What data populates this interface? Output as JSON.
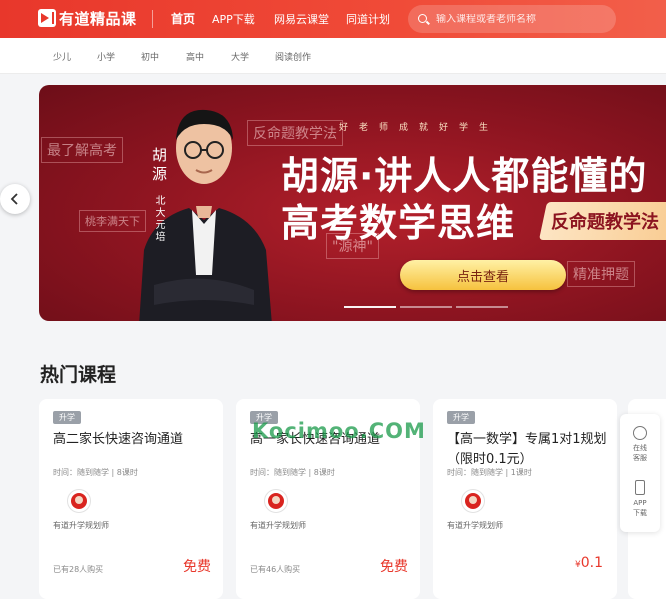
{
  "header": {
    "logo_text": "有道精品课",
    "nav": [
      {
        "label": "首页",
        "active": true
      },
      {
        "label": "APP下载",
        "active": false
      },
      {
        "label": "网易云课堂",
        "active": false
      },
      {
        "label": "同道计划",
        "active": false
      }
    ],
    "search_placeholder": "输入课程或者老师名称"
  },
  "subnav": [
    "少儿",
    "小学",
    "初中",
    "高中",
    "大学",
    "阅读创作"
  ],
  "banner": {
    "tags": [
      "反命题教学法",
      "最了解高考",
      "桃李满天下",
      "\"源神\"",
      "精准押题"
    ],
    "teacher_name": "胡源",
    "teacher_title": "北大元培",
    "slogan": "好老师成就好学生",
    "headline_line1": "胡源·讲人人都能懂的",
    "headline_line2": "高考数学思维",
    "ribbon": "反命题教学法",
    "cta": "点击查看",
    "prev_icon": "chevron-left-icon"
  },
  "section_title": "热门课程",
  "watermark": "Kocimoo.COM",
  "courses": [
    {
      "badge": "升学",
      "title": "高二家长快速咨询通道",
      "meta": "时间：随到随学 | 8课时",
      "teacher": "有道升学规划师",
      "buyers": "已有28人购买",
      "price": "免费"
    },
    {
      "badge": "升学",
      "title": "高一家长快速咨询通道",
      "meta": "时间：随到随学 | 8课时",
      "teacher": "有道升学规划师",
      "buyers": "已有46人购买",
      "price": "免费"
    },
    {
      "badge": "升学",
      "title": "【高一数学】专属1对1规划（限时0.1元）",
      "meta": "时间：随到随学 | 1课时",
      "teacher": "有道升学规划师",
      "buyers": "",
      "price_symbol": "¥",
      "price": "0.1"
    }
  ],
  "side_tools": [
    {
      "label_line1": "在线",
      "label_line2": "客服",
      "icon": "headset-icon"
    },
    {
      "label_line1": "APP",
      "label_line2": "下载",
      "icon": "phone-icon"
    }
  ],
  "colors": {
    "brand": "#e8372b",
    "banner_bg": "#8c1420",
    "cta": "#f6c23e",
    "badge": "#9aa0a8"
  }
}
